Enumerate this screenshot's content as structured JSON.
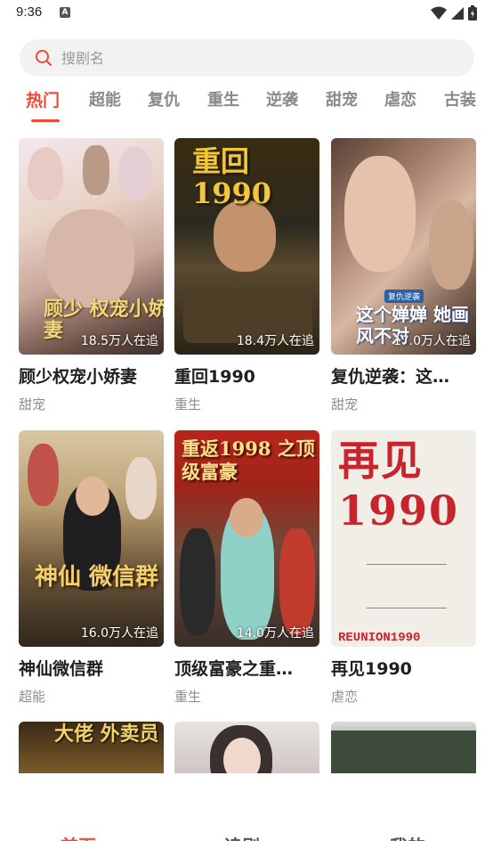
{
  "status_bar": {
    "time": "9:36",
    "notification_icon": "A"
  },
  "search": {
    "placeholder": "搜剧名"
  },
  "tabs": [
    {
      "label": "热门"
    },
    {
      "label": "超能"
    },
    {
      "label": "复仇"
    },
    {
      "label": "重生"
    },
    {
      "label": "逆袭"
    },
    {
      "label": "甜宠"
    },
    {
      "label": "虐恋"
    },
    {
      "label": "古装"
    }
  ],
  "dramas": [
    {
      "title": "顾少权宠小娇妻",
      "genre": "甜宠",
      "followers": "18.5万人在追",
      "poster_text": "顾少 权宠小娇妻"
    },
    {
      "title": "重回1990",
      "genre": "重生",
      "followers": "18.4万人在追",
      "poster_text": "重回 1990"
    },
    {
      "title": "复仇逆袭：这…",
      "genre": "甜宠",
      "followers": "17.0万人在追",
      "poster_text": "这个婵婵 她画风不对",
      "poster_badge": "复仇逆袭"
    },
    {
      "title": "神仙微信群",
      "genre": "超能",
      "followers": "16.0万人在追",
      "poster_text": "神仙 微信群"
    },
    {
      "title": "顶级富豪之重…",
      "genre": "重生",
      "followers": "14.0万人在追",
      "poster_text": "重返1998 之顶级富豪"
    },
    {
      "title": "再见1990",
      "genre": "虐恋",
      "followers": "",
      "poster_text": "再见 1990",
      "poster_subtitle": "REUNION1990"
    }
  ],
  "peek_posters": [
    {
      "poster_text": "大佬 外卖员"
    }
  ],
  "bottom_nav": [
    {
      "label": "首页"
    },
    {
      "label": "追剧"
    },
    {
      "label": "我的"
    }
  ],
  "colors": {
    "accent": "#f04a35",
    "tab_inactive": "#8a8a8a",
    "search_bg": "#f2f2f2"
  }
}
